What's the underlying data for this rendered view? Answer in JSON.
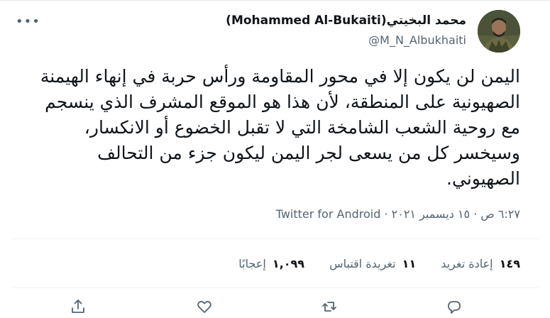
{
  "author": {
    "display_name": "محمد البخيتي(Mohammed Al-Bukaiti)",
    "handle": "@M_N_Albukhaiti"
  },
  "tweet": {
    "text": "اليمن لن يكون إلا في محور المقاومة ورأس حربة في إنهاء الهيمنة الصهيونية على المنطقة، لأن هذا هو الموقع المشرف الذي ينسجم مع روحية الشعب الشامخة التي لا تقبل الخضوع أو الانكسار، وسيخسر كل من يسعى لجر اليمن ليكون جزء من التحالف الصهيوني.",
    "time": "٦:٢٧ ص · ١٥ ديسمبر ٢٠٢١",
    "separator": "·",
    "app": "Twitter for Android"
  },
  "stats": {
    "retweets_num": "١٤٩",
    "retweets_label": "إعادة تغريد",
    "quotes_num": "١١",
    "quotes_label": "تغريدة اقتباس",
    "likes_num": "١,٠٩٩",
    "likes_label": "إعجابًا"
  },
  "icons": {
    "more": "more-icon",
    "reply": "reply-icon",
    "retweet": "retweet-icon",
    "like": "like-icon",
    "share": "share-icon"
  },
  "colors": {
    "text": "#0f1419",
    "secondary": "#536471",
    "divider": "#eff3f4"
  }
}
